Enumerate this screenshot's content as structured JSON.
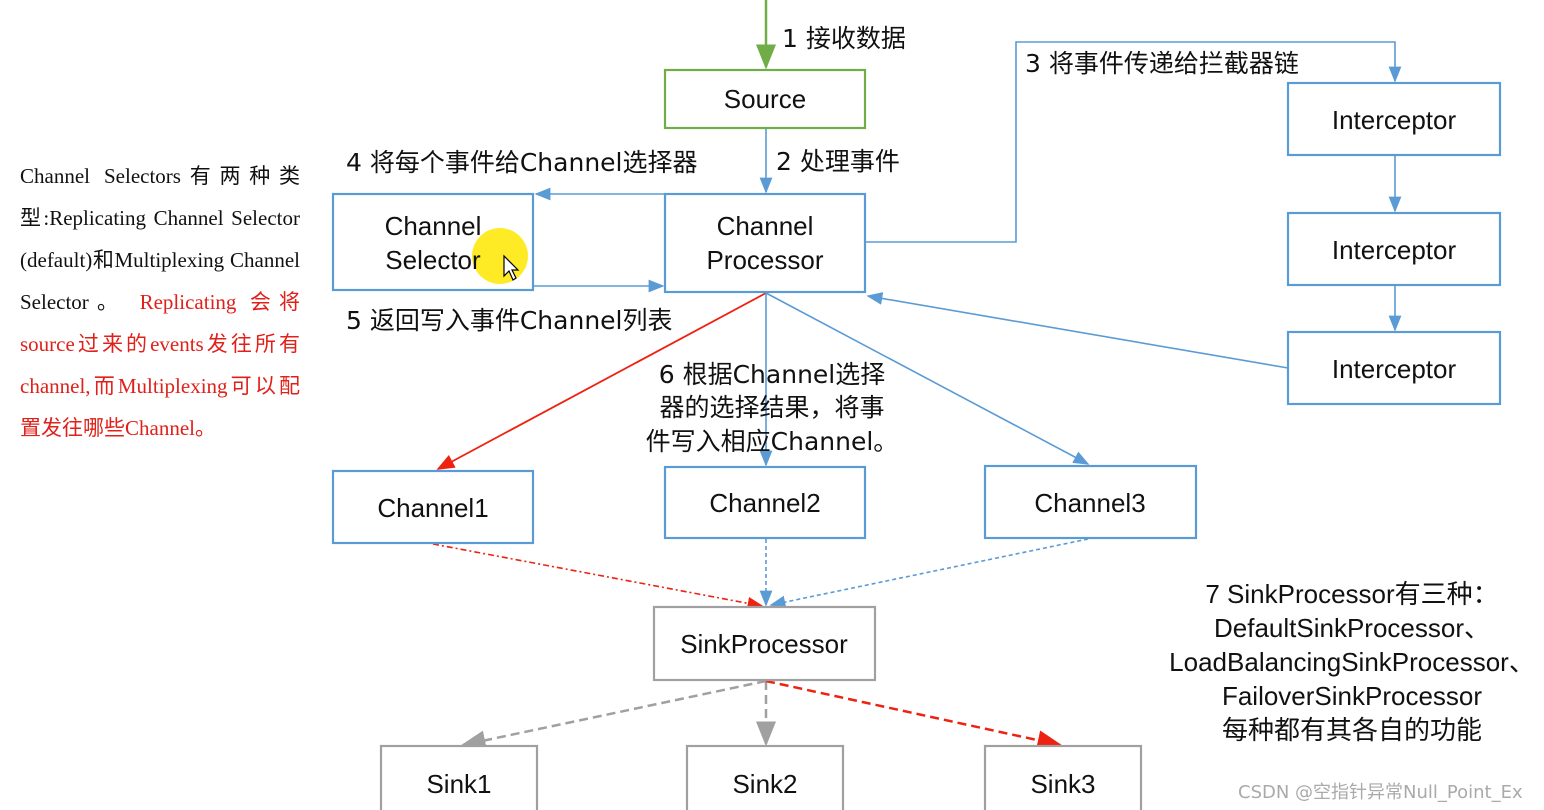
{
  "colors": {
    "blue": "#5b9bd5",
    "green": "#70ad47",
    "red": "#ee2211",
    "gray": "#a0a0a0"
  },
  "sidebar": {
    "line1": "Channel Selectors有两种类型:Replicating Channel Selector (default)和Multiplexing Channel Selector。",
    "line2": "Replicating 会将source过来的events发往所有channel,而Multiplexing可以配置发往哪些Channel。"
  },
  "boxes": {
    "source": "Source",
    "selector_l1": "Channel",
    "selector_l2": "Selector",
    "processor_l1": "Channel",
    "processor_l2": "Processor",
    "interceptor1": "Interceptor",
    "interceptor2": "Interceptor",
    "interceptor3": "Interceptor",
    "channel1": "Channel1",
    "channel2": "Channel2",
    "channel3": "Channel3",
    "sink_processor": "SinkProcessor",
    "sink1": "Sink1",
    "sink2": "Sink2",
    "sink3": "Sink3"
  },
  "steps": {
    "s1": "1 接收数据",
    "s2": "2 处理事件",
    "s3": "3 将事件传递给拦截器链",
    "s4": "4 将每个事件给Channel选择器",
    "s5": "5 返回写入事件Channel列表",
    "s6_l1": "6 根据Channel选择",
    "s6_l2": "器的选择结果，将事",
    "s6_l3": "件写入相应Channel。",
    "s7_l1": "7 SinkProcessor有三种：",
    "s7_l2": "DefaultSinkProcessor、",
    "s7_l3": "LoadBalancingSinkProcessor、",
    "s7_l4": "FailoverSinkProcessor",
    "s7_l5": "每种都有其各自的功能"
  },
  "watermark": "CSDN @空指针异常Null_Point_Ex"
}
